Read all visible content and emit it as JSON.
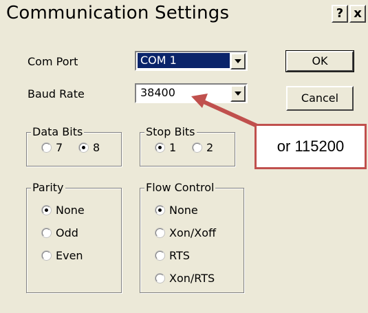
{
  "dialog": {
    "title": "Communication Settings",
    "help_btn": "?",
    "close_btn": "x"
  },
  "com_port": {
    "label": "Com Port",
    "value": "COM 1"
  },
  "baud_rate": {
    "label": "Baud Rate",
    "value": "38400"
  },
  "buttons": {
    "ok": "OK",
    "cancel": "Cancel"
  },
  "data_bits": {
    "title": "Data Bits",
    "options": [
      "7",
      "8"
    ],
    "selected": "8"
  },
  "stop_bits": {
    "title": "Stop Bits",
    "options": [
      "1",
      "2"
    ],
    "selected": "1"
  },
  "parity": {
    "title": "Parity",
    "options": [
      "None",
      "Odd",
      "Even"
    ],
    "selected": "None"
  },
  "flow_control": {
    "title": "Flow Control",
    "options": [
      "None",
      "Xon/Xoff",
      "RTS",
      "Xon/RTS"
    ],
    "selected": "None"
  },
  "annotation": {
    "text": "or 115200",
    "color": "#c0504d"
  }
}
